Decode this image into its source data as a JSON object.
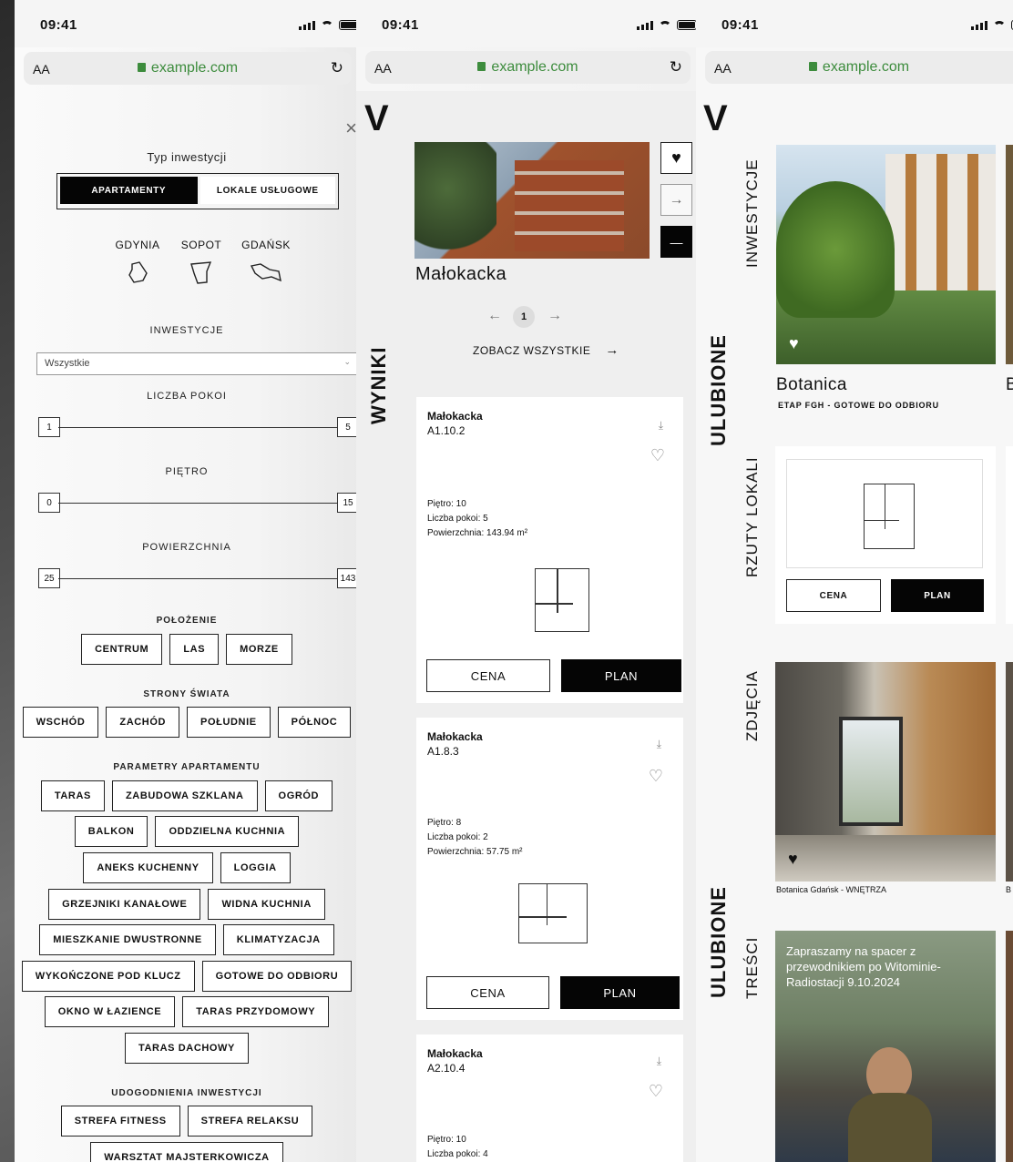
{
  "status": {
    "time": "09:41"
  },
  "browser": {
    "aa": "AA",
    "url": "example.com",
    "reload": "↻"
  },
  "filters": {
    "close": "×",
    "type_label": "Typ inwestycji",
    "type_options": [
      "APARTAMENTY",
      "LOKALE USŁUGOWE"
    ],
    "cities": [
      "GDYNIA",
      "SOPOT",
      "GDAŃSK"
    ],
    "investments_label": "INWESTYCJE",
    "investments_value": "Wszystkie",
    "rooms_label": "LICZBA POKOI",
    "rooms_min": "1",
    "rooms_max": "5",
    "floor_label": "PIĘTRO",
    "floor_min": "0",
    "floor_max": "15",
    "area_label": "POWIERZCHNIA",
    "area_min": "25",
    "area_max": "143",
    "location_label": "POŁOŻENIE",
    "location": [
      "CENTRUM",
      "LAS",
      "MORZE"
    ],
    "directions_label": "STRONY ŚWIATA",
    "directions": [
      "WSCHÓD",
      "ZACHÓD",
      "POŁUDNIE",
      "PÓŁNOC"
    ],
    "params_label": "PARAMETRY APARTAMENTU",
    "params": [
      [
        "TARAS",
        "ZABUDOWA SZKLANA",
        "OGRÓD"
      ],
      [
        "BALKON",
        "ODDZIELNA KUCHNIA"
      ],
      [
        "ANEKS KUCHENNY",
        "LOGGIA"
      ],
      [
        "GRZEJNIKI KANAŁOWE",
        "WIDNA KUCHNIA"
      ],
      [
        "MIESZKANIE DWUSTRONNE",
        "KLIMATYZACJA"
      ],
      [
        "WYKOŃCZONE POD KLUCZ",
        "GOTOWE DO ODBIORU"
      ],
      [
        "OKNO W ŁAZIENCE",
        "TARAS PRZYDOMOWY"
      ],
      [
        "TARAS DACHOWY"
      ]
    ],
    "amenities_label": "UDOGODNIENIA INWESTYCJI",
    "amenities": [
      [
        "STREFA FITNESS",
        "STREFA RELAKSU"
      ],
      [
        "WARSZTAT MAJSTERKOWICZA"
      ]
    ]
  },
  "results": {
    "logo": "V",
    "side_title": "WYNIKI",
    "featured_name": "Małokacka",
    "page": "1",
    "see_all": "ZOBACZ WSZYSTKIE",
    "cards": [
      {
        "name": "Małokacka",
        "code": "A1.10.2",
        "floor": "Piętro: 10",
        "rooms": "Liczba pokoi: 5",
        "area": "Powierzchnia: 143.94 m²",
        "cena": "CENA",
        "plan": "PLAN"
      },
      {
        "name": "Małokacka",
        "code": "A1.8.3",
        "floor": "Piętro: 8",
        "rooms": "Liczba pokoi: 2",
        "area": "Powierzchnia: 57.75 m²",
        "cena": "CENA",
        "plan": "PLAN"
      },
      {
        "name": "Małokacka",
        "code": "A2.10.4",
        "floor": "Piętro: 10",
        "rooms": "Liczba pokoi: 4",
        "area": "",
        "cena": "",
        "plan": ""
      }
    ]
  },
  "favorites": {
    "logo": "V",
    "section_title": "ULUBIONE",
    "section_title_2": "ULUBIONE",
    "investments_label": "INWESTYCJE",
    "investment_name": "Botanica",
    "investment_next": "B",
    "investment_sub": "ETAP FGH - GOTOWE DO ODBIORU",
    "plans_label": "RZUTY LOKALI",
    "cena": "CENA",
    "plan": "PLAN",
    "photos_label": "ZDJĘCIA",
    "photo_caption": "Botanica Gdańsk - WNĘTRZA",
    "photo_caption_next": "B",
    "content_label": "TREŚCI",
    "content_text": "Zapraszamy na spacer z przewodnikiem po Witominie-Radiostacji 9.10.2024"
  }
}
